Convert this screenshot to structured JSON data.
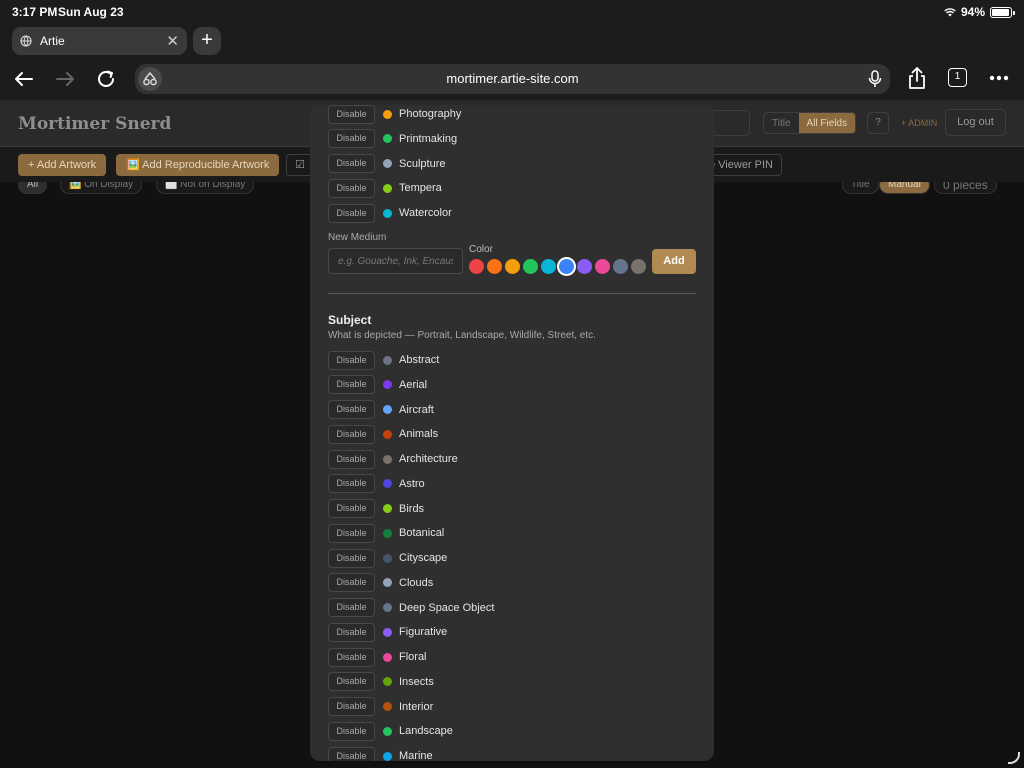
{
  "status": {
    "time": "3:17 PM",
    "date": "Sun Aug 23",
    "battery": "94%",
    "battery_level": 0.94
  },
  "browser": {
    "tab_title": "Artie",
    "url": "mortimer.artie-site.com",
    "tab_count": "1"
  },
  "app": {
    "brand": "Mortimer Snerd",
    "search_modes": [
      "Title",
      "All Fields"
    ],
    "help": "?",
    "admin": "+ ADMIN",
    "logout": "Log out",
    "actions": {
      "add_artwork": "+ Add Artwork",
      "add_reproducible": "🖼️ Add Reproducible Artwork",
      "checkbox_icon": "☑",
      "viewer_pin": "e Viewer PIN"
    },
    "filters": {
      "all": "All",
      "on_display": "🖼️ On Display",
      "not_on_display": "⬜ Not on Display",
      "sort_title": "Title",
      "sort_manual": "Manual",
      "pieces": "0 pieces"
    }
  },
  "modal": {
    "disable_label": "Disable",
    "mediums": [
      {
        "name": "Photography",
        "color": "#f59e0b"
      },
      {
        "name": "Printmaking",
        "color": "#22c55e"
      },
      {
        "name": "Sculpture",
        "color": "#94a3b8"
      },
      {
        "name": "Tempera",
        "color": "#84cc16"
      },
      {
        "name": "Watercolor",
        "color": "#06b6d4"
      }
    ],
    "new_medium": {
      "label": "New Medium",
      "placeholder": "e.g. Gouache, Ink, Encaustic",
      "color_label": "Color",
      "colors": [
        "#ef4444",
        "#f97316",
        "#f59e0b",
        "#22c55e",
        "#06b6d4",
        "#3b82f6",
        "#8b5cf6",
        "#ec4899",
        "#64748b",
        "#78716c"
      ],
      "selected_color_index": 5,
      "add_label": "Add"
    },
    "subject": {
      "title": "Subject",
      "description": "What is depicted — Portrait, Landscape, Wildlife, Street, etc.",
      "items": [
        {
          "name": "Abstract",
          "color": "#6b7280"
        },
        {
          "name": "Aerial",
          "color": "#7c3aed"
        },
        {
          "name": "Aircraft",
          "color": "#60a5fa"
        },
        {
          "name": "Animals",
          "color": "#c2410c"
        },
        {
          "name": "Architecture",
          "color": "#78716c"
        },
        {
          "name": "Astro",
          "color": "#4f46e5"
        },
        {
          "name": "Birds",
          "color": "#84cc16"
        },
        {
          "name": "Botanical",
          "color": "#15803d"
        },
        {
          "name": "Cityscape",
          "color": "#475569"
        },
        {
          "name": "Clouds",
          "color": "#94a3b8"
        },
        {
          "name": "Deep Space Object",
          "color": "#64748b"
        },
        {
          "name": "Figurative",
          "color": "#8b5cf6"
        },
        {
          "name": "Floral",
          "color": "#ec4899"
        },
        {
          "name": "Insects",
          "color": "#65a30d"
        },
        {
          "name": "Interior",
          "color": "#b45309"
        },
        {
          "name": "Landscape",
          "color": "#22c55e"
        },
        {
          "name": "Marine",
          "color": "#0ea5e9"
        }
      ]
    }
  }
}
